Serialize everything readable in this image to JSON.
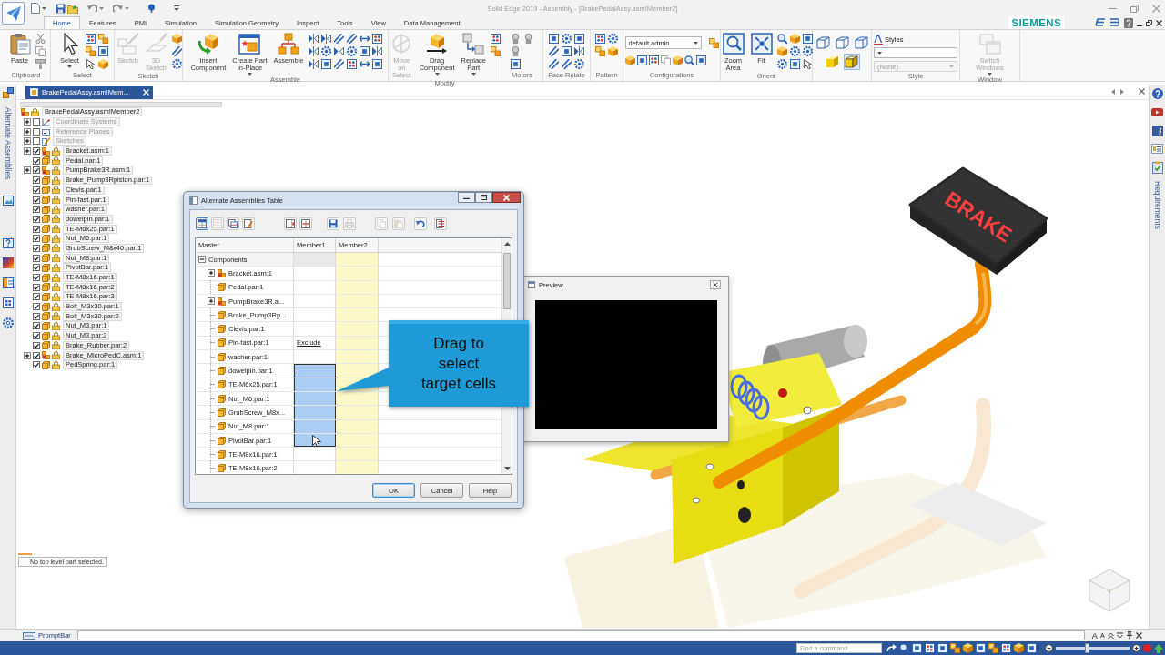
{
  "app_window": {
    "title": "Solid Edge 2019 - Assembly - [BrakePedalAssy.asm!Member2]",
    "brand": "SIEMENS"
  },
  "ribbon": {
    "tabs": [
      {
        "label": "Home",
        "selected": true
      },
      {
        "label": "Features",
        "selected": false
      },
      {
        "label": "PMI",
        "selected": false
      },
      {
        "label": "Simulation",
        "selected": false
      },
      {
        "label": "Simulation Geometry",
        "selected": false
      },
      {
        "label": "Inspect",
        "selected": false
      },
      {
        "label": "Tools",
        "selected": false
      },
      {
        "label": "View",
        "selected": false
      },
      {
        "label": "Data Management",
        "selected": false
      }
    ],
    "groups": [
      {
        "kind": "buttons",
        "label": "Clipboard",
        "buttons": [
          {
            "label": "Paste",
            "disabled": false,
            "menu": false
          }
        ]
      },
      {
        "kind": "buttons",
        "label": "Select",
        "buttons": [
          {
            "label": "Select",
            "disabled": false,
            "menu": true
          }
        ]
      },
      {
        "kind": "buttons",
        "label": "Sketch",
        "buttons": [
          {
            "label": "Sketch",
            "disabled": true,
            "menu": false
          },
          {
            "label": "3D\nSketch",
            "disabled": true,
            "menu": false
          }
        ]
      },
      {
        "kind": "buttons",
        "label": "Assemble",
        "buttons": [
          {
            "label": "Insert\nComponent",
            "disabled": false,
            "menu": false
          },
          {
            "label": "Create Part\nIn-Place",
            "disabled": false,
            "menu": true
          },
          {
            "label": "Assemble",
            "disabled": false,
            "menu": false
          }
        ]
      },
      {
        "kind": "buttons",
        "label": "Modify",
        "buttons": [
          {
            "label": "Move on\nSelect",
            "disabled": true,
            "menu": false
          },
          {
            "label": "Drag\nComponent",
            "disabled": false,
            "menu": true
          },
          {
            "label": "Replace\nPart",
            "disabled": false,
            "menu": true
          }
        ]
      },
      {
        "kind": "buttons",
        "label": "Motors"
      },
      {
        "kind": "buttons",
        "label": "Face Relate"
      },
      {
        "kind": "buttons",
        "label": "Pattern"
      },
      {
        "kind": "configurations",
        "label": "Configurations",
        "dropdown": {
          "value": "default,admin"
        }
      },
      {
        "kind": "buttons",
        "label": "Orient",
        "buttons": [
          {
            "label": "Zoom\nArea",
            "disabled": false,
            "menu": false
          },
          {
            "label": "Fit",
            "disabled": false,
            "menu": false
          }
        ]
      },
      {
        "kind": "views",
        "views": [
          {
            "selected": false
          },
          {
            "selected": false
          },
          {
            "selected": false
          },
          {
            "selected": false
          },
          {
            "selected": true
          }
        ]
      },
      {
        "kind": "style",
        "label": "Style",
        "heading": "Styles",
        "dropdowns": [
          {
            "disabled": false
          },
          {
            "value": "(None)",
            "disabled": true
          }
        ]
      },
      {
        "kind": "buttons",
        "label": "Window",
        "buttons": [
          {
            "label": "Switch\nWindows",
            "disabled": true,
            "menu": true
          }
        ]
      }
    ]
  },
  "document_tab": {
    "label": "BrakePedalAssy.asm!Mem..."
  },
  "left_panel": {
    "tab_label": "Alternate Assemblies"
  },
  "tree": {
    "label": "BrakePedalAssy.asm!Member2",
    "kind": "assembly",
    "children": [
      {
        "label": "Coordinate Systems",
        "kind": "coordinate-systems",
        "checked": false,
        "expanded": false
      },
      {
        "label": "Reference Planes",
        "kind": "reference-planes",
        "checked": false,
        "expanded": false
      },
      {
        "label": "Sketches",
        "kind": "sketches",
        "checked": false,
        "expanded": false
      },
      {
        "label": "Bracket.asm:1",
        "kind": "assembly",
        "checked": true,
        "expanded": false
      },
      {
        "label": "Pedal.par:1",
        "kind": "part",
        "checked": true
      },
      {
        "label": "PumpBrake3R.asm:1",
        "kind": "assembly",
        "checked": true,
        "expanded": false
      },
      {
        "label": "Brake_Pump3Rpiston.par:1",
        "kind": "part",
        "checked": true
      },
      {
        "label": "Clevis.par:1",
        "kind": "part",
        "checked": true
      },
      {
        "label": "Pin-fast.par:1",
        "kind": "part",
        "checked": true
      },
      {
        "label": "washer.par:1",
        "kind": "part",
        "checked": true
      },
      {
        "label": "dowelpin.par:1",
        "kind": "part",
        "checked": true
      },
      {
        "label": "TE-M6x25.par:1",
        "kind": "part",
        "checked": true
      },
      {
        "label": "Nut_M6.par:1",
        "kind": "part",
        "checked": true
      },
      {
        "label": "GrubScrew_M8x40.par:1",
        "kind": "part",
        "checked": true
      },
      {
        "label": "Nut_M8.par:1",
        "kind": "part",
        "checked": true
      },
      {
        "label": "PivotBar.par:1",
        "kind": "part",
        "checked": true
      },
      {
        "label": "TE-M8x16.par:1",
        "kind": "part",
        "checked": true
      },
      {
        "label": "TE-M8x16.par:2",
        "kind": "part",
        "checked": true
      },
      {
        "label": "TE-M8x16.par:3",
        "kind": "part",
        "checked": true
      },
      {
        "label": "Bolt_M3x30.par:1",
        "kind": "part",
        "checked": true
      },
      {
        "label": "Bolt_M3x30.par:2",
        "kind": "part",
        "checked": true
      },
      {
        "label": "Nut_M3.par:1",
        "kind": "part",
        "checked": true
      },
      {
        "label": "Nut_M3.par:2",
        "kind": "part",
        "checked": true
      },
      {
        "label": "Brake_Rubber.par:2",
        "kind": "part",
        "checked": true
      },
      {
        "label": "Brake_MicroPedC.asm:1",
        "kind": "assembly",
        "checked": true,
        "expanded": false
      },
      {
        "label": "PedSpring.par:1",
        "kind": "part",
        "checked": true
      }
    ]
  },
  "dialog": {
    "title": "Alternate Assemblies Table",
    "tools": [
      {
        "selected": true,
        "disabled": false
      },
      {
        "selected": false,
        "disabled": true
      },
      {
        "selected": false,
        "disabled": false
      },
      {
        "selected": false,
        "disabled": false
      },
      {
        "selected": false,
        "disabled": false
      },
      {
        "selected": false,
        "disabled": false
      },
      {
        "selected": false,
        "disabled": false
      },
      {
        "selected": false,
        "disabled": true
      },
      {
        "selected": false,
        "disabled": true
      },
      {
        "selected": false,
        "disabled": true
      },
      {
        "selected": false,
        "disabled": false
      },
      {
        "selected": false,
        "disabled": false
      }
    ],
    "columns": [
      {
        "label": "Master",
        "active": false
      },
      {
        "label": "Member1",
        "active": false
      },
      {
        "label": "Member2",
        "active": true
      }
    ],
    "rows": [
      {
        "label": "Components",
        "kind": "group",
        "expanded": true,
        "children": [
          {
            "label": "Bracket.asm:1",
            "kind": "assembly",
            "expanded": false,
            "member1_selected": false
          },
          {
            "label": "Pedal.par:1",
            "kind": "part",
            "member1_selected": false
          },
          {
            "label": "PumpBrake3R.a...",
            "kind": "assembly",
            "expanded": false,
            "member1_selected": false
          },
          {
            "label": "Brake_Pump3Rp...",
            "kind": "part",
            "member1_selected": false
          },
          {
            "label": "Clevis.par:1",
            "kind": "part",
            "member1_selected": false
          },
          {
            "label": "Pin-fast.par:1",
            "kind": "part",
            "member1": "Exclude",
            "member1_selected": false
          },
          {
            "label": "washer.par:1",
            "kind": "part",
            "member1_selected": false
          },
          {
            "label": "dowelpin.par:1",
            "kind": "part",
            "member1_selected": true
          },
          {
            "label": "TE-M6x25.par:1",
            "kind": "part",
            "member1_selected": true
          },
          {
            "label": "Nut_M6.par:1",
            "kind": "part",
            "member1_selected": true
          },
          {
            "label": "GrubScrew_M8x...",
            "kind": "part",
            "member1_selected": true
          },
          {
            "label": "Nut_M8.par:1",
            "kind": "part",
            "member1_selected": true
          },
          {
            "label": "PivotBar.par:1",
            "kind": "part",
            "member1_selected": true
          },
          {
            "label": "TE-M8x16.par:1",
            "kind": "part",
            "member1_selected": false
          },
          {
            "label": "TE-M8x16.par:2",
            "kind": "part",
            "member1_selected": false
          }
        ]
      }
    ],
    "buttons": [
      {
        "label": "OK",
        "default": true
      },
      {
        "label": "Cancel",
        "default": false
      },
      {
        "label": "Help",
        "default": false
      }
    ]
  },
  "callout": {
    "text": "Drag to select target cells"
  },
  "preview": {
    "title": "Preview"
  },
  "viewport": {
    "model_label": "BRAKE"
  },
  "status_message": {
    "text": "No top level part selected."
  },
  "prompt_bar": {
    "label": "PromptBar",
    "font_buttons": [
      {
        "label": "A",
        "kind": "larger"
      },
      {
        "label": "A",
        "kind": "smaller"
      }
    ]
  },
  "status_bar": {
    "command_search": {
      "placeholder": "Find a command"
    },
    "zoom": {
      "level": 0.42
    }
  },
  "right_panel": {
    "tab_label": "Requirements"
  }
}
